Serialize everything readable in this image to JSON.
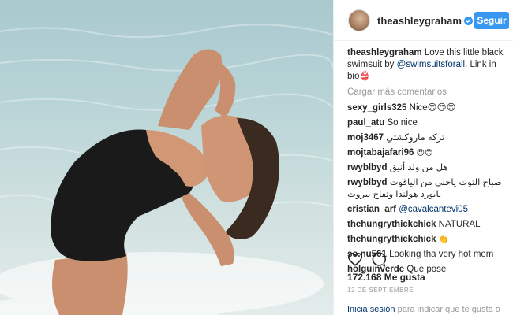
{
  "header": {
    "username": "theashleygraham",
    "follow_label": "Seguir"
  },
  "caption": {
    "username": "theashleygraham",
    "text_before": "Love this little black swimsuit by",
    "mention": "@swimsuitsforall",
    "text_after": ". Link in bio👙"
  },
  "load_more": "Cargar más comentarios",
  "comments": [
    {
      "user": "sexy_girls325",
      "text": "Nice😍😍😍"
    },
    {
      "user": "paul_atu",
      "text": "So nice"
    },
    {
      "user": "moj3467",
      "text": "تركه ماروكشتي"
    },
    {
      "user": "mojtabajafari96",
      "text": "😍😊"
    },
    {
      "user": "rwyblbyd",
      "text": "هل من ولد أنيق"
    },
    {
      "user": "rwyblbyd",
      "text": "صباح التوت ياحلى من الياقوت يابورد هولندا وتفاح بيروت"
    },
    {
      "user": "cristian_arf",
      "mention": "@cavalcantevi05"
    },
    {
      "user": "thehungrythickchick",
      "text": "NATURAL"
    },
    {
      "user": "thehungrythickchick",
      "text": "👏"
    },
    {
      "user": "so.nu561",
      "text": "Looking tha very hot mem"
    },
    {
      "user": "holguinverde",
      "text": "Que pose"
    }
  ],
  "likes": "172.168 Me gusta",
  "date": "12 DE SEPTIEMBRE",
  "login": {
    "link": "Inicia sesión",
    "text": "para indicar que te gusta o"
  },
  "icons": {
    "verified": "verified-badge-icon",
    "like": "heart-icon",
    "comment": "comment-bubble-icon"
  },
  "colors": {
    "follow_button": "#3897f0",
    "link": "#003569",
    "muted": "#999999"
  }
}
